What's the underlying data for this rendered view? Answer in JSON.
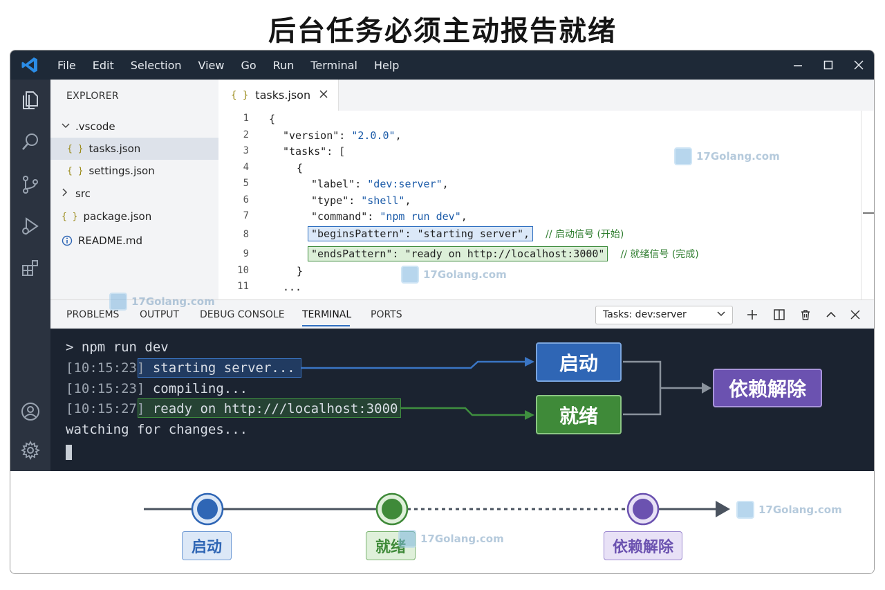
{
  "page_title": "后台任务必须主动报告就绪",
  "menu": [
    "File",
    "Edit",
    "Selection",
    "View",
    "Go",
    "Run",
    "Terminal",
    "Help"
  ],
  "explorer": {
    "title": "EXPLORER",
    "items": [
      {
        "label": ".vscode",
        "kind": "folder-open"
      },
      {
        "label": "tasks.json",
        "kind": "json",
        "selected": true
      },
      {
        "label": "settings.json",
        "kind": "json"
      },
      {
        "label": "src",
        "kind": "folder"
      },
      {
        "label": "package.json",
        "kind": "json"
      },
      {
        "label": "README.md",
        "kind": "info"
      }
    ]
  },
  "editor": {
    "tab_label": "tasks.json",
    "line_numbers": [
      "1",
      "2",
      "3",
      "4",
      "5",
      "6",
      "7",
      "8",
      "9",
      "10",
      "11"
    ],
    "lines": {
      "l1": "{",
      "l2_key": "\"version\"",
      "l2_val": "\"2.0.0\"",
      "l3_key": "\"tasks\"",
      "l3_rest": ": [",
      "l4": "{",
      "l5_key": "\"label\"",
      "l5_val": "\"dev:server\"",
      "l6_key": "\"type\"",
      "l6_val": "\"shell\"",
      "l7_key": "\"command\"",
      "l7_val": "\"npm run dev\"",
      "l8_hl": "\"beginsPattern\": \"starting server\",",
      "l8_comment": "// 启动信号 (开始)",
      "l9_hl": "\"endsPattern\": \"ready on http://localhost:3000\"",
      "l9_comment": "// 就绪信号 (完成)",
      "l10": "}",
      "l11": "..."
    }
  },
  "panel": {
    "tabs": [
      "PROBLEMS",
      "OUTPUT",
      "DEBUG CONSOLE",
      "TERMINAL",
      "PORTS"
    ],
    "active_tab": "TERMINAL",
    "task_select": "Tasks: dev:server"
  },
  "terminal": {
    "prompt": "> npm run dev",
    "line1_ts": "[10:15:23]",
    "line1_msg": "starting server...",
    "line2_ts": "[10:15:23]",
    "line2_msg": "compiling...",
    "line3_ts": "[10:15:27]",
    "line3_msg": "ready on http:///localhost:3000",
    "line4": "watching for changes..."
  },
  "flow": {
    "start": "启动",
    "ready": "就绪",
    "dependency": "依赖解除"
  },
  "timeline": {
    "start": "启动",
    "ready": "就绪",
    "dependency": "依赖解除"
  },
  "watermark": "17Golang.com",
  "colors": {
    "blue": "#2f66b5",
    "green": "#3f8a39",
    "purple": "#6b52b0",
    "titlebar": "#1e2937",
    "terminal_bg": "#1b2330"
  }
}
